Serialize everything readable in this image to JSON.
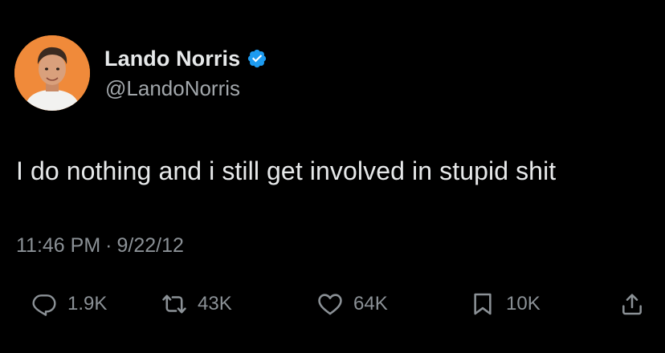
{
  "author": {
    "display_name": "Lando Norris",
    "handle": "@LandoNorris",
    "verified": true,
    "avatar_bg": "#f08a3a"
  },
  "tweet": {
    "text": "I do nothing and i still get involved in stupid shit",
    "time": "11:46 PM",
    "separator": "·",
    "date": "9/22/12"
  },
  "actions": {
    "reply": {
      "icon": "reply-icon",
      "count": "1.9K"
    },
    "retweet": {
      "icon": "retweet-icon",
      "count": "43K"
    },
    "like": {
      "icon": "heart-icon",
      "count": "64K"
    },
    "bookmark": {
      "icon": "bookmark-icon",
      "count": "10K"
    },
    "share": {
      "icon": "share-icon"
    }
  },
  "colors": {
    "background": "#000000",
    "primary_text": "#e7e9ea",
    "secondary_text": "#8b9196",
    "verified_blue": "#1d9bf0"
  }
}
